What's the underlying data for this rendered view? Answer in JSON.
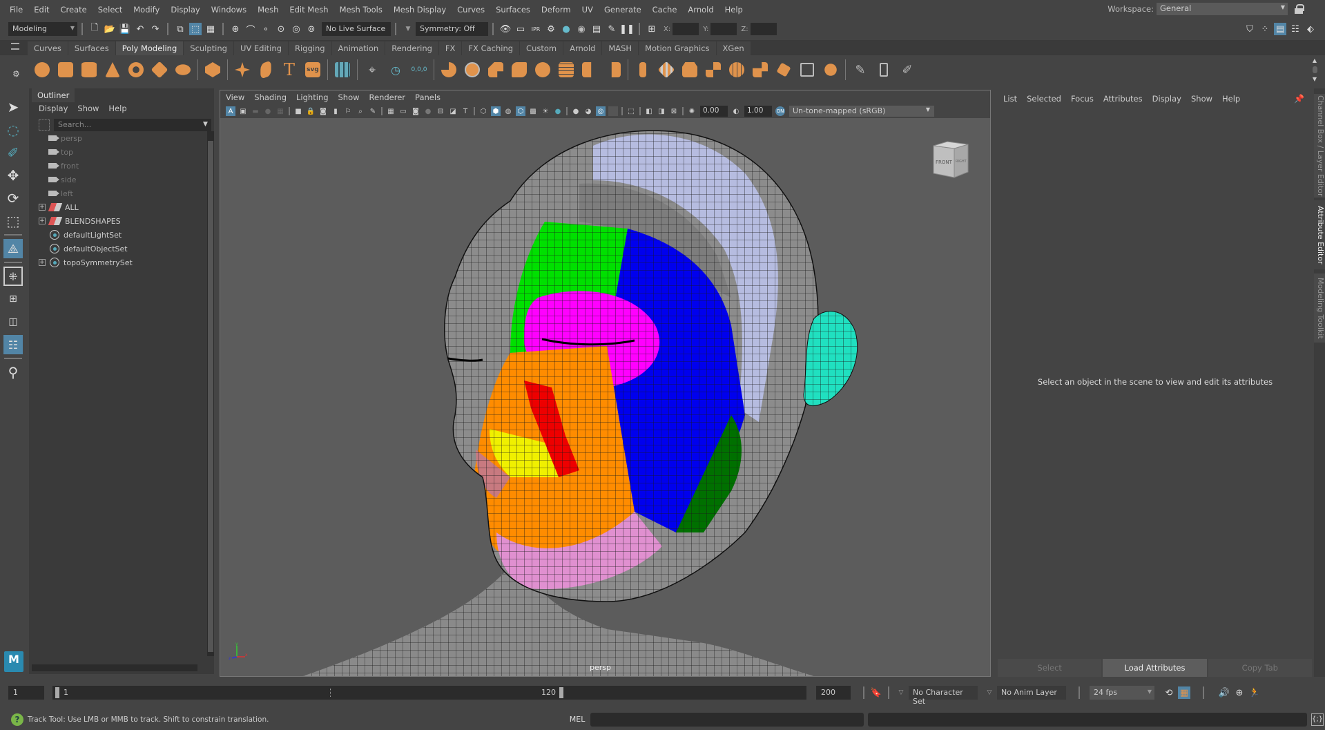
{
  "menubar": {
    "items": [
      "File",
      "Edit",
      "Create",
      "Select",
      "Modify",
      "Display",
      "Windows",
      "Mesh",
      "Edit Mesh",
      "Mesh Tools",
      "Mesh Display",
      "Curves",
      "Surfaces",
      "Deform",
      "UV",
      "Generate",
      "Cache",
      "Arnold",
      "Help"
    ],
    "workspace_label": "Workspace:",
    "workspace_value": "General"
  },
  "statusline": {
    "mode": "Modeling",
    "live_surface": "No Live Surface",
    "symmetry": "Symmetry: Off",
    "x_label": "X:",
    "y_label": "Y:",
    "z_label": "Z:"
  },
  "shelf": {
    "tabs": [
      "Curves",
      "Surfaces",
      "Poly Modeling",
      "Sculpting",
      "UV Editing",
      "Rigging",
      "Animation",
      "Rendering",
      "FX",
      "FX Caching",
      "Custom",
      "Arnold",
      "MASH",
      "Motion Graphics",
      "XGen"
    ],
    "active_tab": "Poly Modeling",
    "text_icon": "T",
    "svg_icon": "svg",
    "xyz_label": "0,0,0"
  },
  "outliner": {
    "title": "Outliner",
    "menu": [
      "Display",
      "Show",
      "Help"
    ],
    "search_placeholder": "Search...",
    "items": [
      {
        "label": "persp",
        "type": "camera",
        "dim": true,
        "expandable": false
      },
      {
        "label": "top",
        "type": "camera",
        "dim": true,
        "expandable": false
      },
      {
        "label": "front",
        "type": "camera",
        "dim": true,
        "expandable": false
      },
      {
        "label": "side",
        "type": "camera",
        "dim": true,
        "expandable": false
      },
      {
        "label": "left",
        "type": "camera",
        "dim": true,
        "expandable": false
      },
      {
        "label": "ALL",
        "type": "objectset",
        "dim": false,
        "expandable": true
      },
      {
        "label": "BLENDSHAPES",
        "type": "objectset",
        "dim": false,
        "expandable": true
      },
      {
        "label": "defaultLightSet",
        "type": "set",
        "dim": false,
        "expandable": false
      },
      {
        "label": "defaultObjectSet",
        "type": "set",
        "dim": false,
        "expandable": false
      },
      {
        "label": "topoSymmetrySet",
        "type": "set",
        "dim": false,
        "expandable": true
      }
    ]
  },
  "viewport": {
    "menu": [
      "View",
      "Shading",
      "Lighting",
      "Show",
      "Renderer",
      "Panels"
    ],
    "exposure": "0.00",
    "gamma": "1.00",
    "color_space": "Un-tone-mapped (sRGB)",
    "camera_name": "persp",
    "viewcube_front": "FRONT",
    "viewcube_right": "RIGHT",
    "axis_labels": {
      "x": "x",
      "y": "y",
      "z": "z"
    }
  },
  "attribute_editor": {
    "menu": [
      "List",
      "Selected",
      "Focus",
      "Attributes",
      "Display",
      "Show",
      "Help"
    ],
    "message": "Select an object in the scene to view and edit its attributes",
    "buttons": [
      {
        "label": "Select",
        "active": false
      },
      {
        "label": "Load Attributes",
        "active": true
      },
      {
        "label": "Copy Tab",
        "active": false
      }
    ]
  },
  "side_tabs": [
    {
      "label": "Channel Box / Layer Editor",
      "active": false
    },
    {
      "label": "Attribute Editor",
      "active": true
    },
    {
      "label": "Modeling Toolkit",
      "active": false
    }
  ],
  "timeline": {
    "start_frame": "1",
    "range_start": "1",
    "range_end": "120",
    "end_frame": "200",
    "character_set": "No Character Set",
    "anim_layer": "No Anim Layer",
    "fps": "24 fps"
  },
  "helpline": {
    "message": "Track Tool: Use LMB or MMB to track. Shift to constrain translation.",
    "script_lang": "MEL"
  },
  "colors": {
    "accent": "#5285a6",
    "shelf_icon": "#e0934c",
    "bg": "#444444",
    "viewport_bg": "#5c5c5c"
  }
}
